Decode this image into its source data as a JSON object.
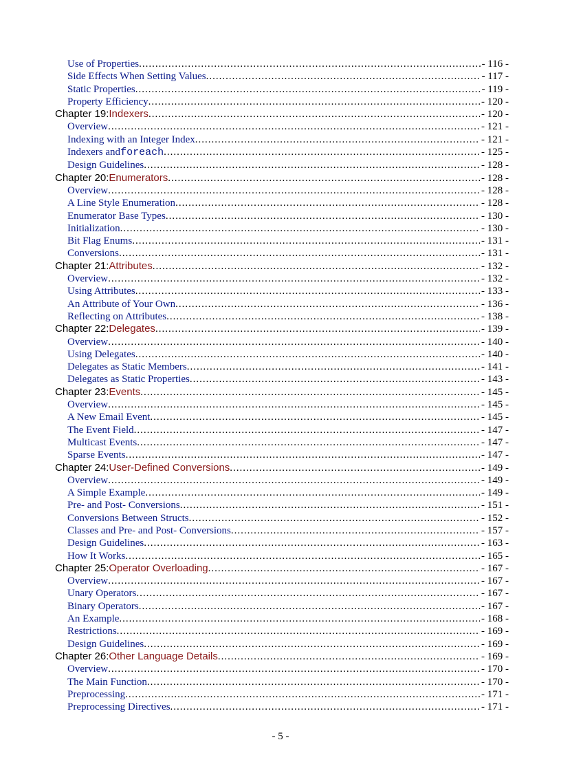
{
  "pageNumber": "- 5 -",
  "entries": [
    {
      "type": "sub",
      "title": "Use of Properties",
      "page": "- 116 -"
    },
    {
      "type": "sub",
      "title": "Side Effects When Setting Values",
      "page": "- 117 -"
    },
    {
      "type": "sub",
      "title": "Static Properties",
      "page": "- 119 -"
    },
    {
      "type": "sub",
      "title": "Property Efficiency",
      "page": "- 120 -"
    },
    {
      "type": "chapter",
      "prefix": "Chapter 19",
      "title": "Indexers",
      "page": "- 120 -"
    },
    {
      "type": "sub",
      "title": "Overview",
      "page": "- 121 -"
    },
    {
      "type": "sub",
      "title": "Indexing with an Integer Index",
      "page": "- 121 -"
    },
    {
      "type": "sub",
      "title": "Indexers and ",
      "code": "foreach",
      "page": "- 125 -"
    },
    {
      "type": "sub",
      "title": "Design Guidelines",
      "page": "- 128 -"
    },
    {
      "type": "chapter",
      "prefix": "Chapter 20",
      "title": "Enumerators",
      "page": "- 128 -"
    },
    {
      "type": "sub",
      "title": "Overview",
      "page": "- 128 -"
    },
    {
      "type": "sub",
      "title": "A Line Style Enumeration",
      "page": "- 128 -"
    },
    {
      "type": "sub",
      "title": "Enumerator Base Types",
      "page": "- 130 -"
    },
    {
      "type": "sub",
      "title": "Initialization",
      "page": "- 130 -"
    },
    {
      "type": "sub",
      "title": "Bit Flag Enums",
      "page": "- 131 -"
    },
    {
      "type": "sub",
      "title": "Conversions",
      "page": "- 131 -"
    },
    {
      "type": "chapter",
      "prefix": "Chapter 21",
      "title": "Attributes",
      "page": "- 132 -"
    },
    {
      "type": "sub",
      "title": "Overview",
      "page": "- 132 -"
    },
    {
      "type": "sub",
      "title": "Using Attributes",
      "page": "- 133 -"
    },
    {
      "type": "sub",
      "title": "An Attribute of Your Own",
      "page": "- 136 -"
    },
    {
      "type": "sub",
      "title": "Reflecting on Attributes",
      "page": "- 138 -"
    },
    {
      "type": "chapter",
      "prefix": "Chapter 22",
      "title": "Delegates",
      "page": "- 139 -"
    },
    {
      "type": "sub",
      "title": "Overview",
      "page": "- 140 -"
    },
    {
      "type": "sub",
      "title": "Using Delegates",
      "page": "- 140 -"
    },
    {
      "type": "sub",
      "title": "Delegates as Static Members",
      "page": "- 141 -"
    },
    {
      "type": "sub",
      "title": "Delegates as Static Properties",
      "page": "- 143 -"
    },
    {
      "type": "chapter",
      "prefix": "Chapter 23",
      "title": "Events",
      "page": "- 145 -"
    },
    {
      "type": "sub",
      "title": "Overview",
      "page": "- 145 -"
    },
    {
      "type": "sub",
      "title": "A New Email Event",
      "page": "- 145 -"
    },
    {
      "type": "sub",
      "title": "The Event Field",
      "page": "- 147 -"
    },
    {
      "type": "sub",
      "title": "Multicast Events",
      "page": "- 147 -"
    },
    {
      "type": "sub",
      "title": "Sparse Events",
      "page": "- 147 -"
    },
    {
      "type": "chapter",
      "prefix": "Chapter 24",
      "title": "User-Defined Conversions",
      "page": "- 149 -"
    },
    {
      "type": "sub",
      "title": "Overview",
      "page": "- 149 -"
    },
    {
      "type": "sub",
      "title": "A Simple Example",
      "page": "- 149 -"
    },
    {
      "type": "sub",
      "title": "Pre- and Post- Conversions",
      "page": "- 151 -"
    },
    {
      "type": "sub",
      "title": "Conversions Between Structs",
      "page": "- 152 -"
    },
    {
      "type": "sub",
      "title": "Classes and Pre- and Post- Conversions",
      "page": "- 157 -"
    },
    {
      "type": "sub",
      "title": "Design Guidelines",
      "page": "- 163 -"
    },
    {
      "type": "sub",
      "title": "How It Works",
      "page": "- 165 -"
    },
    {
      "type": "chapter",
      "prefix": "Chapter 25",
      "title": "Operator Overloading",
      "page": "- 167 -"
    },
    {
      "type": "sub",
      "title": "Overview",
      "page": "- 167 -"
    },
    {
      "type": "sub",
      "title": "Unary Operators",
      "page": "- 167 -"
    },
    {
      "type": "sub",
      "title": "Binary Operators",
      "page": "- 167 -"
    },
    {
      "type": "sub",
      "title": "An Example",
      "page": "- 168 -"
    },
    {
      "type": "sub",
      "title": "Restrictions",
      "page": "- 169 -"
    },
    {
      "type": "sub",
      "title": "Design Guidelines",
      "page": "- 169 -"
    },
    {
      "type": "chapter",
      "prefix": "Chapter 26",
      "title": "Other Language Details",
      "page": "- 169 -"
    },
    {
      "type": "sub",
      "title": "Overview",
      "page": "- 170 -"
    },
    {
      "type": "sub",
      "title": "The Main Function",
      "page": "- 170 -"
    },
    {
      "type": "sub",
      "title": "Preprocessing",
      "page": "- 171 -"
    },
    {
      "type": "sub",
      "title": "Preprocessing Directives",
      "page": "- 171 -"
    }
  ]
}
